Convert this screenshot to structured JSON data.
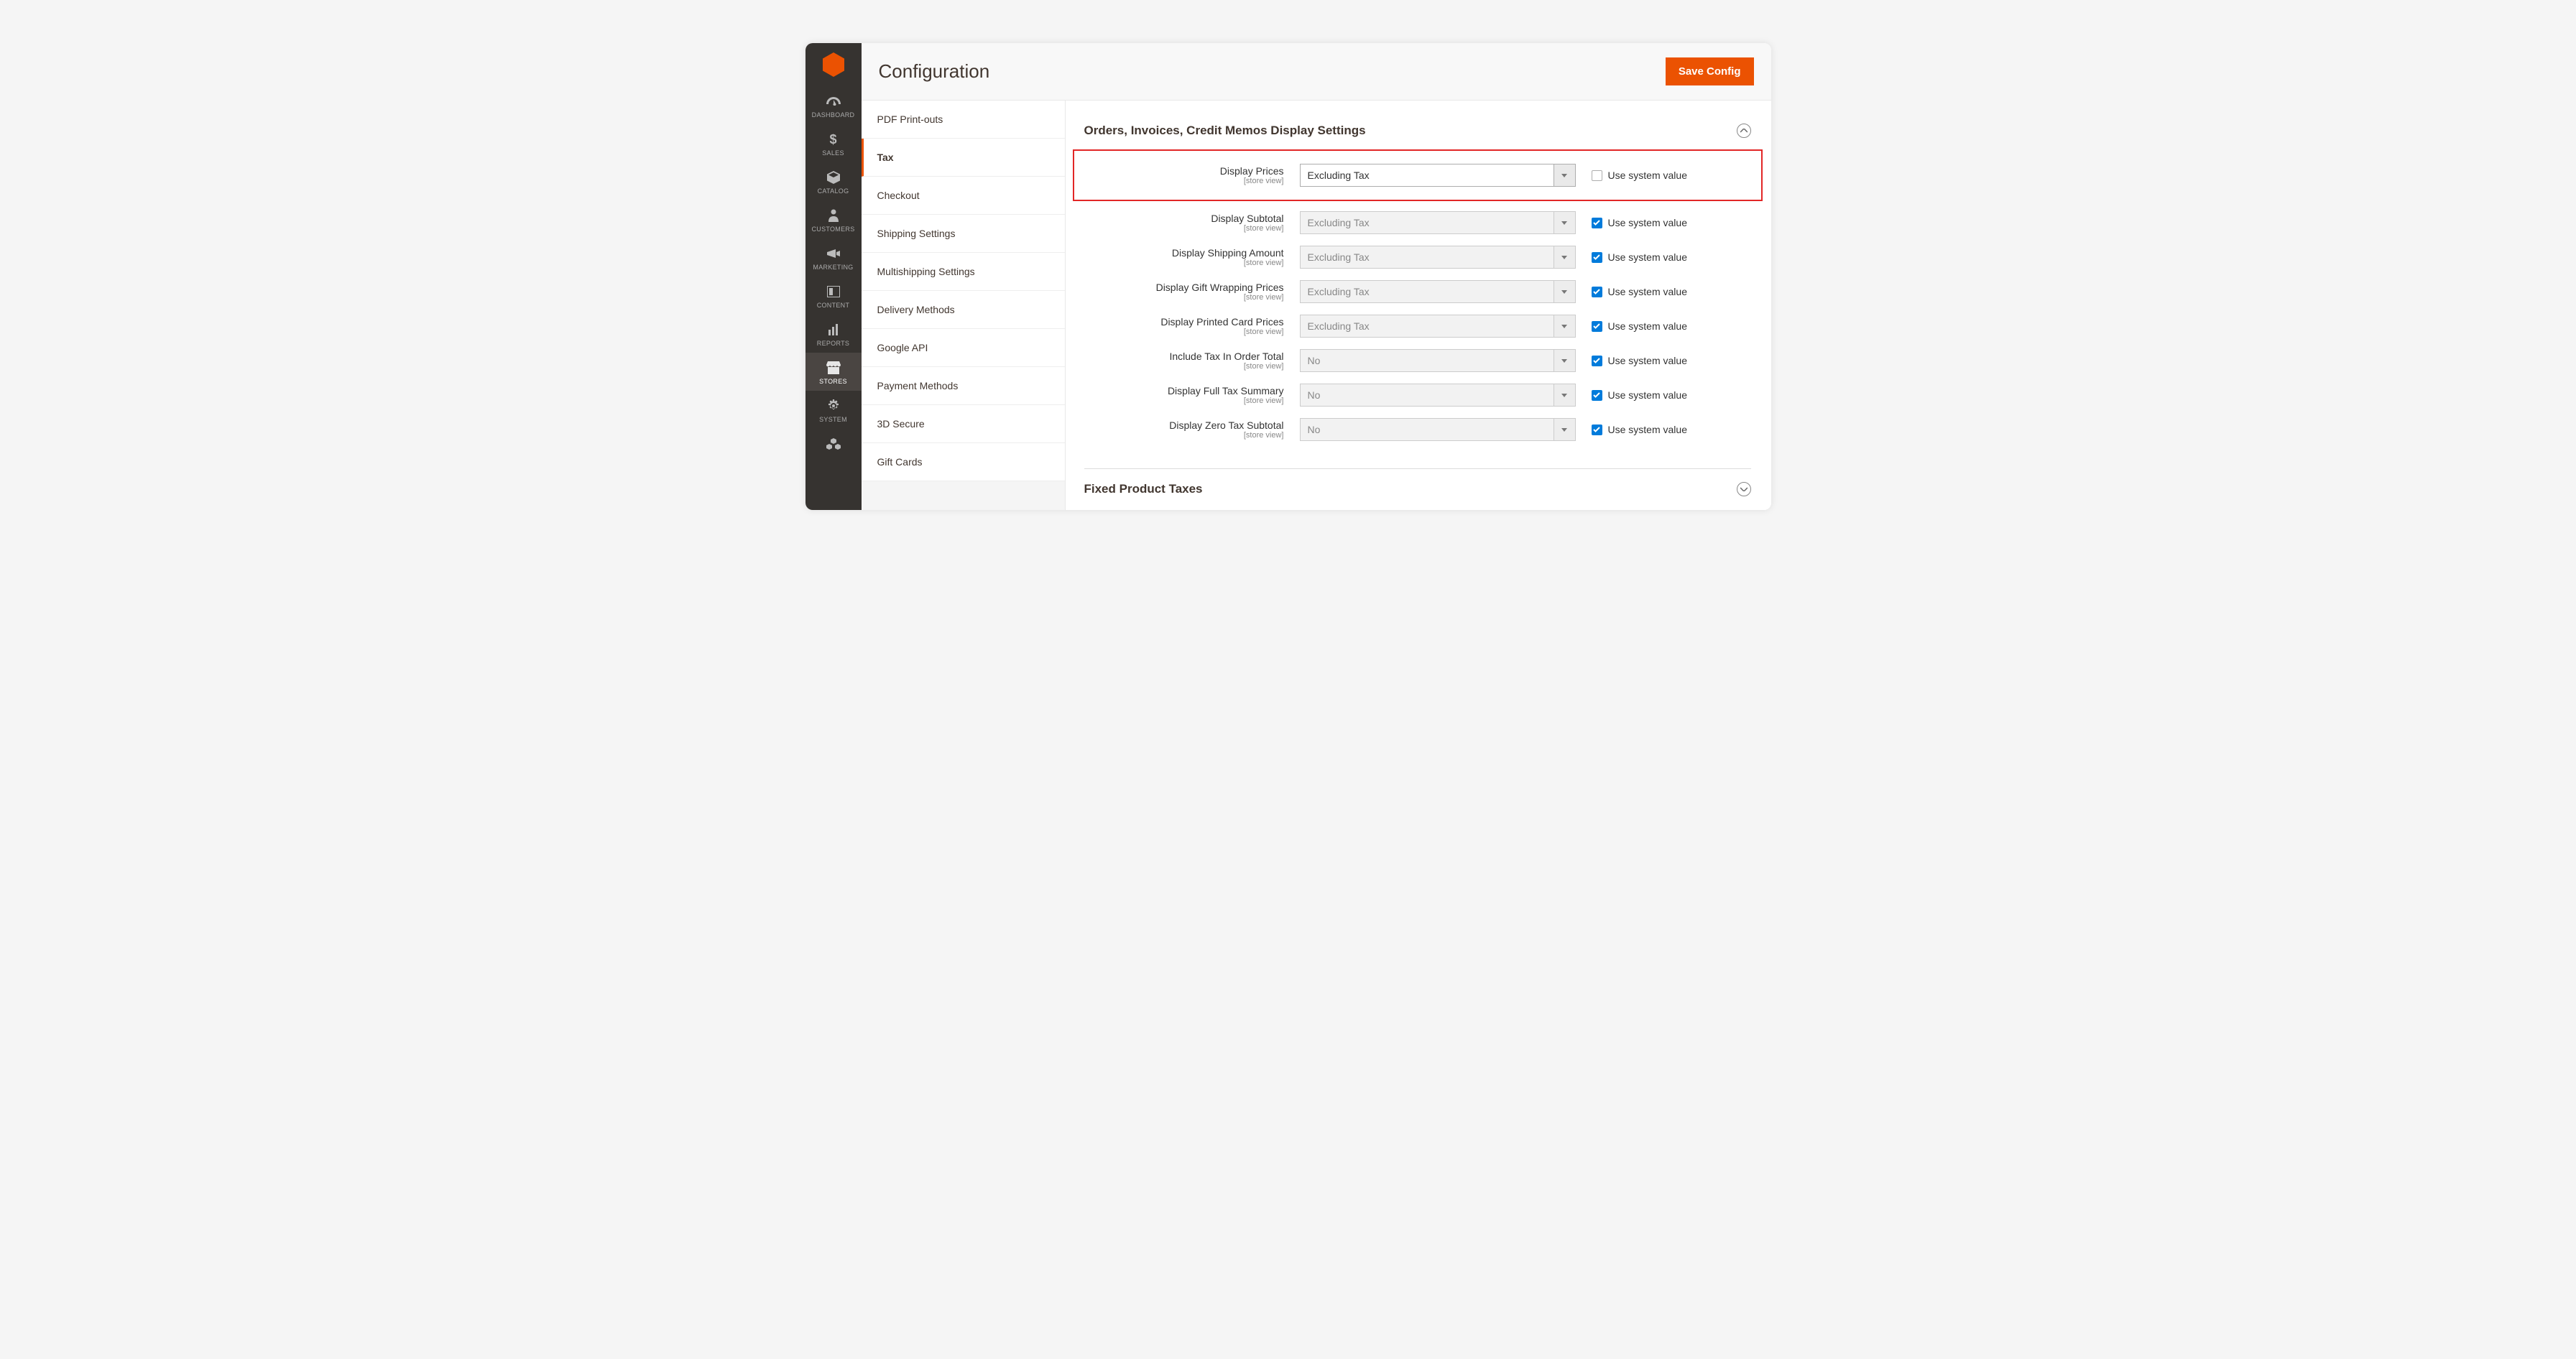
{
  "header": {
    "title": "Configuration",
    "save_button": "Save Config"
  },
  "sidebar": {
    "items": [
      {
        "label": "DASHBOARD"
      },
      {
        "label": "SALES"
      },
      {
        "label": "CATALOG"
      },
      {
        "label": "CUSTOMERS"
      },
      {
        "label": "MARKETING"
      },
      {
        "label": "CONTENT"
      },
      {
        "label": "REPORTS"
      },
      {
        "label": "STORES"
      },
      {
        "label": "SYSTEM"
      },
      {
        "label": ""
      }
    ]
  },
  "config_nav": {
    "items": [
      {
        "label": "PDF Print-outs"
      },
      {
        "label": "Tax"
      },
      {
        "label": "Checkout"
      },
      {
        "label": "Shipping Settings"
      },
      {
        "label": "Multishipping Settings"
      },
      {
        "label": "Delivery Methods"
      },
      {
        "label": "Google API"
      },
      {
        "label": "Payment Methods"
      },
      {
        "label": "3D Secure"
      },
      {
        "label": "Gift Cards"
      }
    ],
    "active_index": 1
  },
  "section1": {
    "title": "Orders, Invoices, Credit Memos Display Settings",
    "fields": [
      {
        "label": "Display Prices",
        "scope": "[store view]",
        "value": "Excluding Tax",
        "use_system": false,
        "use_system_label": "Use system value",
        "highlighted": true
      },
      {
        "label": "Display Subtotal",
        "scope": "[store view]",
        "value": "Excluding Tax",
        "use_system": true,
        "use_system_label": "Use system value"
      },
      {
        "label": "Display Shipping Amount",
        "scope": "[store view]",
        "value": "Excluding Tax",
        "use_system": true,
        "use_system_label": "Use system value"
      },
      {
        "label": "Display Gift Wrapping Prices",
        "scope": "[store view]",
        "value": "Excluding Tax",
        "use_system": true,
        "use_system_label": "Use system value"
      },
      {
        "label": "Display Printed Card Prices",
        "scope": "[store view]",
        "value": "Excluding Tax",
        "use_system": true,
        "use_system_label": "Use system value"
      },
      {
        "label": "Include Tax In Order Total",
        "scope": "[store view]",
        "value": "No",
        "use_system": true,
        "use_system_label": "Use system value"
      },
      {
        "label": "Display Full Tax Summary",
        "scope": "[store view]",
        "value": "No",
        "use_system": true,
        "use_system_label": "Use system value"
      },
      {
        "label": "Display Zero Tax Subtotal",
        "scope": "[store view]",
        "value": "No",
        "use_system": true,
        "use_system_label": "Use system value"
      }
    ]
  },
  "section2": {
    "title": "Fixed Product Taxes"
  }
}
